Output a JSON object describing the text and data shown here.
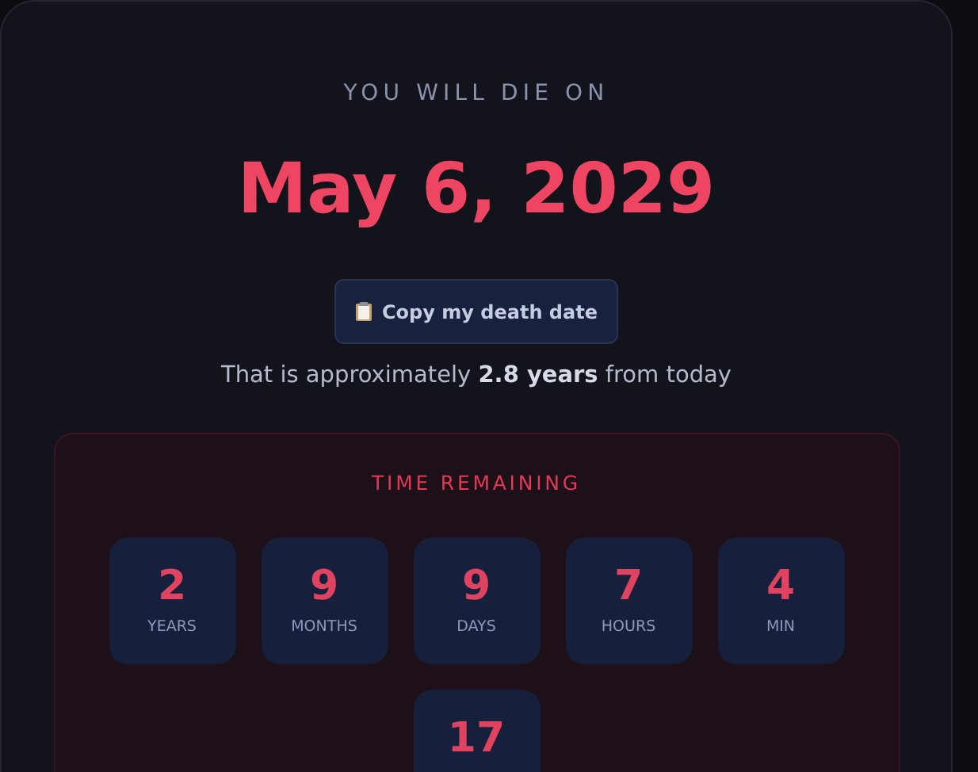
{
  "header": {
    "eyebrow": "YOU WILL DIE ON",
    "date": "May 6, 2029"
  },
  "copy_button": {
    "label": "Copy my death date"
  },
  "summary": "That is approximately **2.8 years** from today",
  "countdown": {
    "title": "TIME REMAINING",
    "units": [
      {
        "value": "2",
        "label": "YEARS"
      },
      {
        "value": "9",
        "label": "MONTHS"
      },
      {
        "value": "9",
        "label": "DAYS"
      },
      {
        "value": "7",
        "label": "HOURS"
      },
      {
        "value": "4",
        "label": "MIN"
      },
      {
        "value": "17"
      }
    ]
  }
}
